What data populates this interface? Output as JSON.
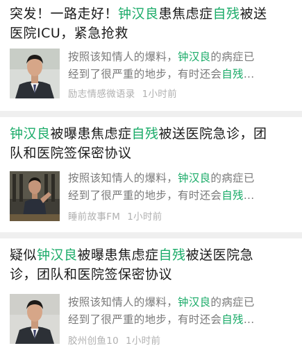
{
  "results": [
    {
      "title_parts": [
        {
          "text": "突发！一路走好！",
          "hl": false
        },
        {
          "text": "钟汉良",
          "hl": true
        },
        {
          "text": "患焦虑症",
          "hl": false
        },
        {
          "text": "自残",
          "hl": true
        },
        {
          "text": "被送",
          "hl": false
        },
        {
          "text": "医院ICU，紧急抢救",
          "hl": false
        }
      ],
      "snippet_parts": [
        {
          "text": "按照该知情人的爆料，",
          "hl": false
        },
        {
          "text": "钟汉良",
          "hl": true
        },
        {
          "text": "的病症已",
          "hl": false
        },
        {
          "text": "经到了很严重的地步，有时还会",
          "hl": false
        },
        {
          "text": "自残",
          "hl": true
        },
        {
          "text": "...",
          "hl": false
        }
      ],
      "source": "励志情感微语录",
      "time": "1小时前"
    },
    {
      "title_parts": [
        {
          "text": "钟汉良",
          "hl": true
        },
        {
          "text": "被曝患焦虑症",
          "hl": false
        },
        {
          "text": "自残",
          "hl": true
        },
        {
          "text": "被送医院急诊，团",
          "hl": false
        },
        {
          "text": "队和医院签保密协议",
          "hl": false
        }
      ],
      "snippet_parts": [
        {
          "text": "按照该知情人的爆料，",
          "hl": false
        },
        {
          "text": "钟汉良",
          "hl": true
        },
        {
          "text": "的病症已",
          "hl": false
        },
        {
          "text": "经到了很严重的地步，有时还会",
          "hl": false
        },
        {
          "text": "自残",
          "hl": true
        },
        {
          "text": "...",
          "hl": false
        }
      ],
      "source": "睡前故事FM",
      "time": "1小时前"
    },
    {
      "title_parts": [
        {
          "text": "疑似",
          "hl": false
        },
        {
          "text": "钟汉良",
          "hl": true
        },
        {
          "text": "被曝患焦虑症",
          "hl": false
        },
        {
          "text": "自残",
          "hl": true
        },
        {
          "text": "被送医院急",
          "hl": false
        },
        {
          "text": "诊，团队和医院签保密协议",
          "hl": false
        }
      ],
      "snippet_parts": [
        {
          "text": "按照该知情人的爆料，",
          "hl": false
        },
        {
          "text": "钟汉良",
          "hl": true
        },
        {
          "text": "的病症已",
          "hl": false
        },
        {
          "text": "经到了很严重的地步，有时还会",
          "hl": false
        },
        {
          "text": "自残",
          "hl": true
        },
        {
          "text": "...",
          "hl": false
        }
      ],
      "source": "胶州创鱼10",
      "time": "1小时前"
    }
  ],
  "colors": {
    "highlight": "#1aab68",
    "divider": "#efefef",
    "meta": "#b0b0b0",
    "snippet": "#7a7a7a"
  }
}
